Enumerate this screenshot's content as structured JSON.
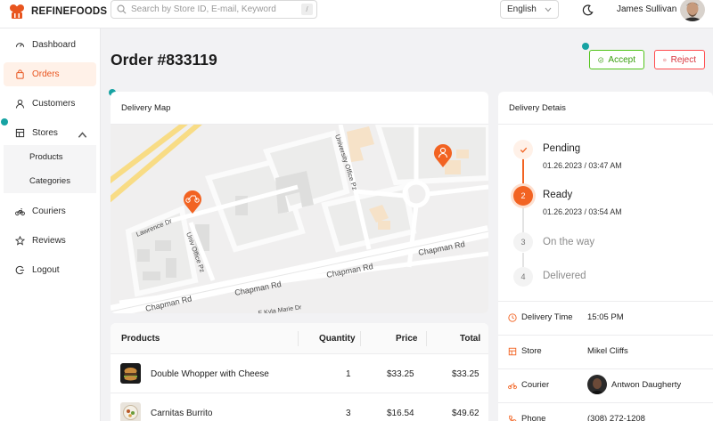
{
  "app": {
    "brand": "REFINEFOODS"
  },
  "search": {
    "placeholder": "Search by Store ID, E-mail, Keyword",
    "shortcut": "/"
  },
  "header": {
    "language": "English",
    "user_name": "James Sullivan"
  },
  "sidebar": {
    "items": [
      {
        "label": "Dashboard",
        "icon": "dashboard-icon"
      },
      {
        "label": "Orders",
        "icon": "shopping-bag-icon",
        "active": true
      },
      {
        "label": "Customers",
        "icon": "user-icon"
      },
      {
        "label": "Stores",
        "icon": "store-icon",
        "expanded": true
      },
      {
        "label": "Couriers",
        "icon": "bike-icon"
      },
      {
        "label": "Reviews",
        "icon": "star-icon"
      },
      {
        "label": "Logout",
        "icon": "logout-icon"
      }
    ],
    "stores_sub": [
      "Products",
      "Categories"
    ]
  },
  "page": {
    "title": "Order #833119",
    "accept_label": "Accept",
    "reject_label": "Reject"
  },
  "map": {
    "title": "Delivery Map",
    "streets": [
      "University Office Pz",
      "Lawrence Dr",
      "Univ Office Pz",
      "Chapman Rd",
      "Chapman Rd",
      "Chapman Rd",
      "Chapman Rd",
      "E Kyla Marie Dr"
    ]
  },
  "products": {
    "columns": [
      "Products",
      "Quantity",
      "Price",
      "Total"
    ],
    "rows": [
      {
        "name": "Double Whopper with Cheese",
        "quantity": "1",
        "price": "$33.25",
        "total": "$33.25"
      },
      {
        "name": "Carnitas Burrito",
        "quantity": "3",
        "price": "$16.54",
        "total": "$49.62"
      }
    ]
  },
  "delivery": {
    "title": "Delivery Detais",
    "steps": [
      {
        "label": "Pending",
        "date": "01.26.2023 / 03:47 AM",
        "state": "done"
      },
      {
        "label": "Ready",
        "date": "01.26.2023 / 03:54 AM",
        "state": "current",
        "number": "2"
      },
      {
        "label": "On the way",
        "date": "",
        "state": "waiting",
        "number": "3"
      },
      {
        "label": "Delivered",
        "date": "",
        "state": "waiting",
        "number": "4"
      }
    ],
    "info": [
      {
        "label": "Delivery Time",
        "value": "15:05 PM",
        "icon": "clock-icon"
      },
      {
        "label": "Store",
        "value": "Mikel Cliffs",
        "icon": "store-icon"
      },
      {
        "label": "Courier",
        "value": "Antwon Daugherty",
        "icon": "bike-icon"
      },
      {
        "label": "Phone",
        "value": "(308) 272-1208",
        "icon": "phone-icon"
      }
    ]
  },
  "colors": {
    "accent": "#e8551f",
    "accept": "#52c41a",
    "reject": "#ff4d4f",
    "tour_dot": "#17a3a3"
  }
}
